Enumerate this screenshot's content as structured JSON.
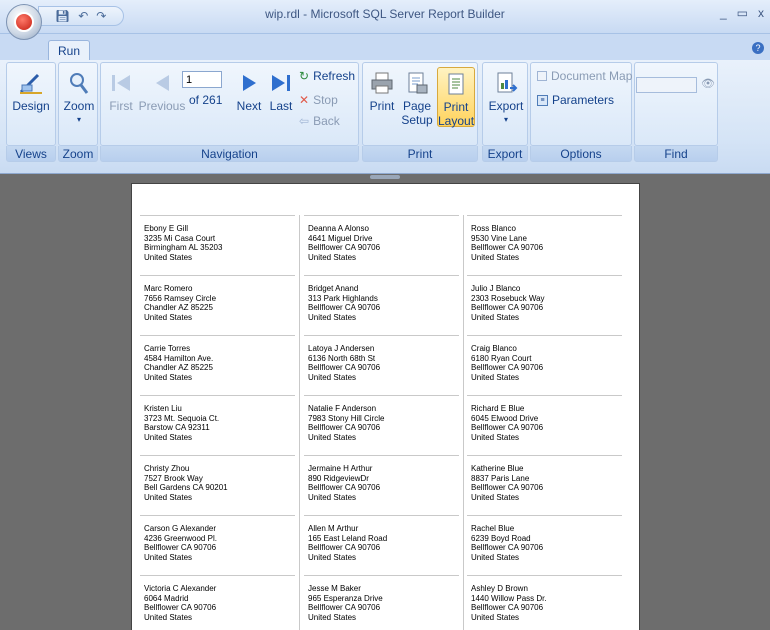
{
  "window": {
    "title": "wip.rdl - Microsoft SQL Server Report Builder",
    "minimize": "_",
    "restore": "▭",
    "close": "x"
  },
  "tabs": [
    {
      "label": "Run"
    }
  ],
  "ribbon": {
    "views": {
      "label": "Views",
      "design": "Design"
    },
    "zoom": {
      "label": "Zoom",
      "zoom": "Zoom"
    },
    "navigation": {
      "label": "Navigation",
      "first": "First",
      "previous": "Previous",
      "page": "1",
      "of_pages": "of 261",
      "next": "Next",
      "last": "Last",
      "refresh": "Refresh",
      "stop": "Stop",
      "back": "Back"
    },
    "print": {
      "label": "Print",
      "print": "Print",
      "page_setup_1": "Page",
      "page_setup_2": "Setup",
      "print_layout_1": "Print",
      "print_layout_2": "Layout"
    },
    "export": {
      "label": "Export",
      "export": "Export"
    },
    "options": {
      "label": "Options",
      "document_map": "Document Map",
      "parameters": "Parameters"
    },
    "find": {
      "label": "Find"
    }
  },
  "labels": [
    [
      "Ebony E Gill",
      "3235 Mi Casa Court",
      "Birmingham AL  35203",
      "United States"
    ],
    [
      "Deanna A Alonso",
      "4641 Miguel Drive",
      "Bellflower CA  90706",
      "United States"
    ],
    [
      "Ross  Blanco",
      "9530 Vine Lane",
      "Bellflower CA  90706",
      "United States"
    ],
    [
      "Marc  Romero",
      "7656 Ramsey Circle",
      "Chandler AZ  85225",
      "United States"
    ],
    [
      "Bridget  Anand",
      "313 Park Highlands",
      "Bellflower CA  90706",
      "United States"
    ],
    [
      "Julio J Blanco",
      "2303 Rosebuck Way",
      "Bellflower CA  90706",
      "United States"
    ],
    [
      "Carrie  Torres",
      "4584 Hamilton Ave.",
      "Chandler AZ  85225",
      "United States"
    ],
    [
      "Latoya J Andersen",
      "6136 North 68th St",
      "Bellflower CA  90706",
      "United States"
    ],
    [
      "Craig  Blanco",
      "6180 Ryan Court",
      "Bellflower CA  90706",
      "United States"
    ],
    [
      "Kristen  Liu",
      "3723 Mt. Sequoia Ct.",
      "Barstow CA  92311",
      "United States"
    ],
    [
      "Natalie F Anderson",
      "7983 Stony Hill Circle",
      "Bellflower CA  90706",
      "United States"
    ],
    [
      "Richard E Blue",
      "6045 Elwood Drive",
      "Bellflower CA  90706",
      "United States"
    ],
    [
      "Christy  Zhou",
      "7527 Brook Way",
      "Bell Gardens CA  90201",
      "United States"
    ],
    [
      "Jermaine H Arthur",
      "890 RidgeviewDr",
      "Bellflower CA  90706",
      "United States"
    ],
    [
      "Katherine  Blue",
      "8837 Paris Lane",
      "Bellflower CA  90706",
      "United States"
    ],
    [
      "Carson G Alexander",
      "4236 Greenwood Pl.",
      "Bellflower CA  90706",
      "United States"
    ],
    [
      "Allen M Arthur",
      "165 East Leland Road",
      "Bellflower CA  90706",
      "United States"
    ],
    [
      "Rachel  Blue",
      "6239 Boyd Road",
      "Bellflower CA  90706",
      "United States"
    ],
    [
      "Victoria C Alexander",
      "6064 Madrid",
      "Bellflower CA  90706",
      "United States"
    ],
    [
      "Jesse M Baker",
      "965 Esperanza Drive",
      "Bellflower CA  90706",
      "United States"
    ],
    [
      "Ashley D Brown",
      "1440 Willow Pass Dr.",
      "Bellflower CA  90706",
      "United States"
    ]
  ]
}
